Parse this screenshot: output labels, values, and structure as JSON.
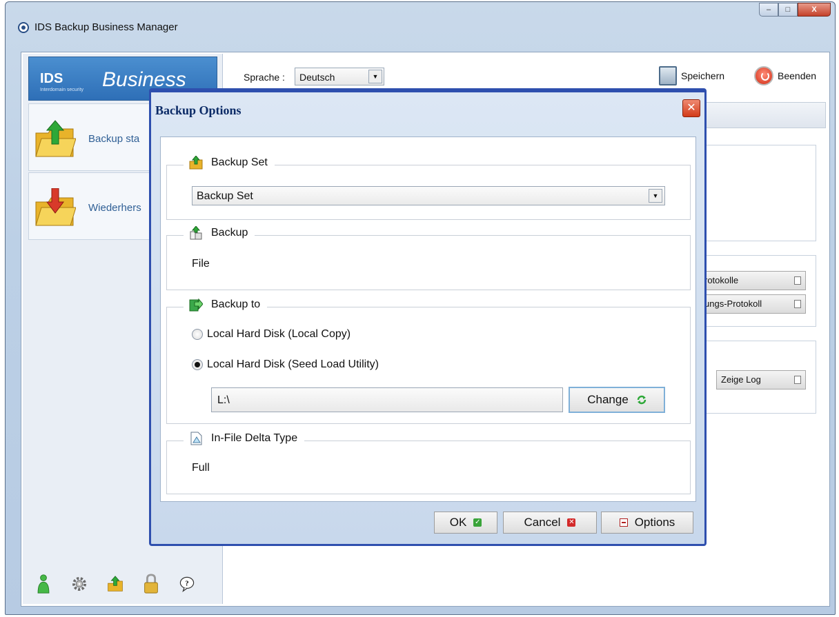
{
  "window": {
    "title": "IDS Backup Business Manager",
    "close_label": "X"
  },
  "brand": {
    "logo": "IDS",
    "name": "Business",
    "tagline": "Interdomain security"
  },
  "sidebar": {
    "items": [
      {
        "label": "Backup sta",
        "icon": "folder-upload-icon"
      },
      {
        "label": "Wiederhers",
        "icon": "folder-restore-icon"
      }
    ],
    "tools": [
      "user-icon",
      "gear-icon",
      "upload-icon",
      "lock-icon",
      "help-icon"
    ]
  },
  "header": {
    "language_label": "Sprache :",
    "language_value": "Deutsch",
    "save_label": "Speichern",
    "exit_label": "Beenden"
  },
  "right_panel": {
    "buttons": [
      "rotokolle",
      "ungs-Protokoll",
      "Zeige Log"
    ]
  },
  "dialog": {
    "title": "Backup Options",
    "backup_set": {
      "legend": "Backup Set",
      "selected": "Backup Set"
    },
    "backup": {
      "legend": "Backup",
      "value": "File"
    },
    "backup_to": {
      "legend": "Backup to",
      "options": [
        {
          "label": "Local Hard Disk (Local Copy)",
          "selected": false
        },
        {
          "label": "Local Hard Disk (Seed Load Utility)",
          "selected": true
        }
      ],
      "path": "L:\\",
      "change_label": "Change"
    },
    "delta": {
      "legend": "In-File Delta Type",
      "value": "Full"
    },
    "buttons": {
      "ok": "OK",
      "cancel": "Cancel",
      "options": "Options"
    }
  },
  "colors": {
    "accent": "#2e4fae",
    "title_text": "#0b2a66",
    "nav_text": "#2f5f95"
  }
}
